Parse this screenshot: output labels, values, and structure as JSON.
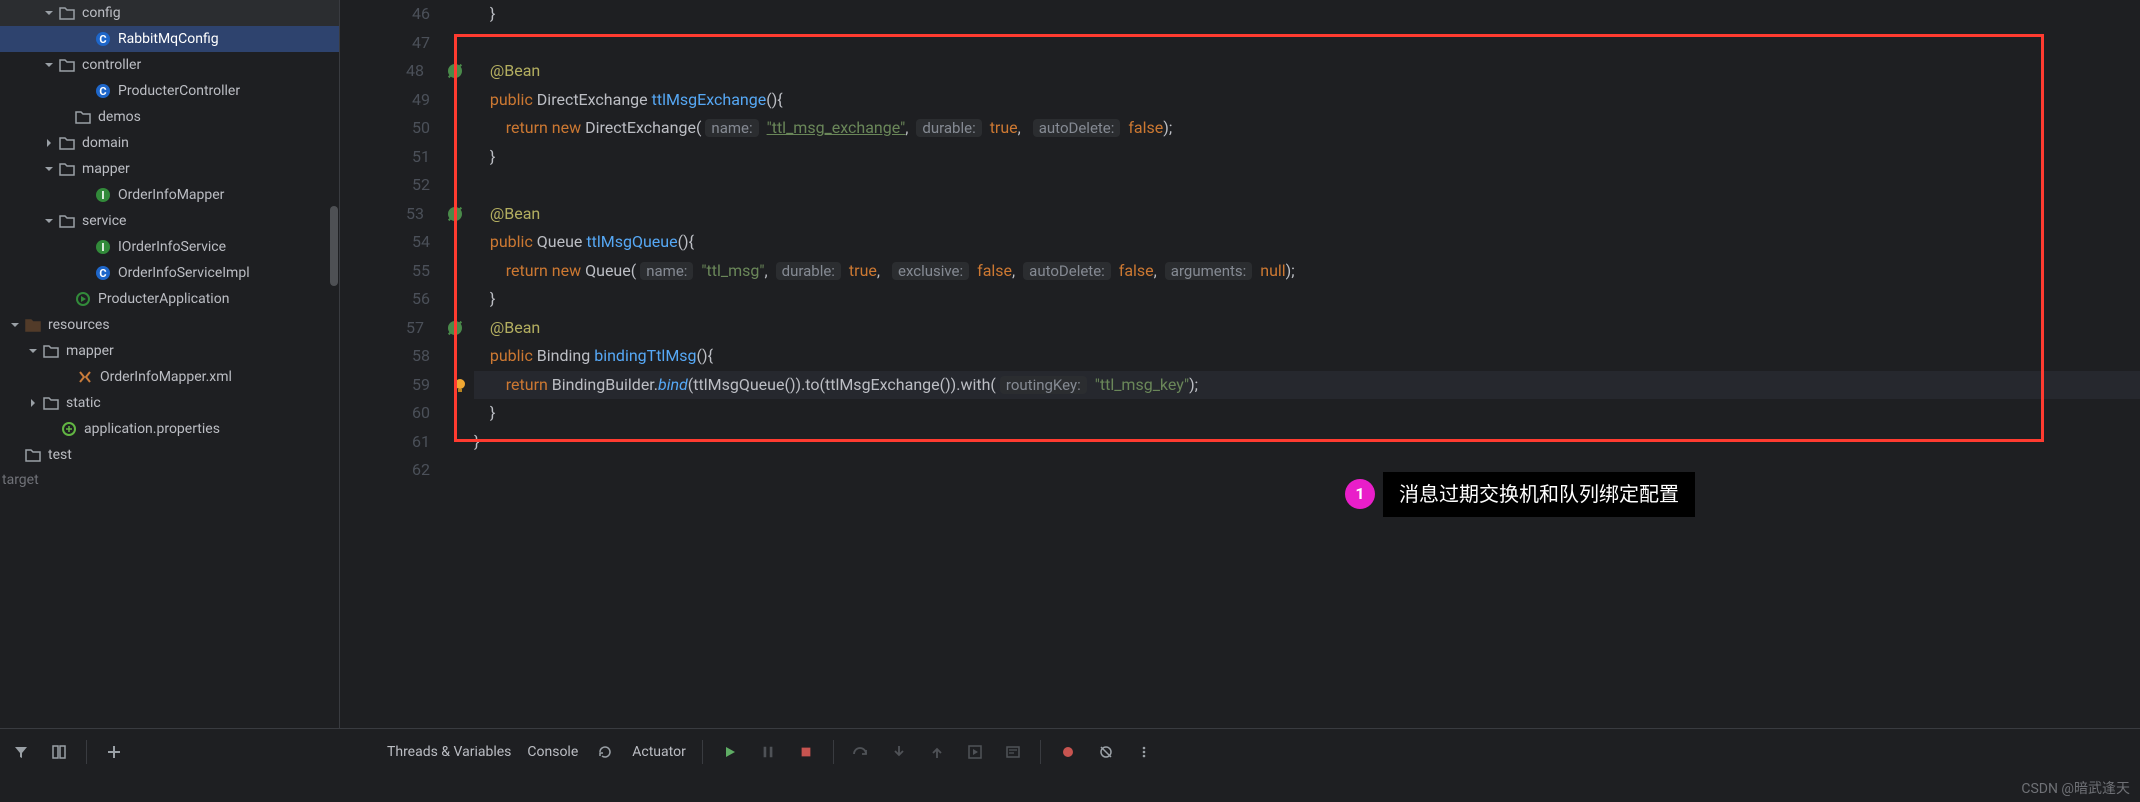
{
  "tree": {
    "config": "config",
    "rabbit": "RabbitMqConfig",
    "controller": "controller",
    "pcontroller": "ProducterController",
    "demos": "demos",
    "domain": "domain",
    "mapper": "mapper",
    "ordermapper": "OrderInfoMapper",
    "service": "service",
    "iorder": "IOrderInfoService",
    "orderimpl": "OrderInfoServiceImpl",
    "papp": "ProducterApplication",
    "resources": "resources",
    "mapperf": "mapper",
    "oxml": "OrderInfoMapper.xml",
    "static": "static",
    "aprop": "application.properties",
    "test": "test",
    "target": "target"
  },
  "lines": [
    "46",
    "47",
    "48",
    "49",
    "50",
    "51",
    "52",
    "53",
    "54",
    "55",
    "56",
    "57",
    "58",
    "59",
    "60",
    "61",
    "62"
  ],
  "code": {
    "bean": "@Bean",
    "public": "public",
    "return": "return",
    "new": "new",
    "direx": "DirectExchange",
    "ttlExFn": "ttlMsgExchange",
    "name": "name:",
    "ttl_ex_str": "\"ttl_msg_exchange\"",
    "durable": "durable:",
    "true": "true",
    "autoDel": "autoDelete:",
    "false": "false",
    "queue": "Queue",
    "ttlQFn": "ttlMsgQueue",
    "ttl_msg_str": "\"ttl_msg\"",
    "exclusive": "exclusive:",
    "arguments": "arguments:",
    "null": "null",
    "binding": "Binding",
    "bindFn": "bindingTtlMsg",
    "bbuilder": "BindingBuilder",
    "bind": "bind",
    "to": "to",
    "with": "with",
    "rkey": "routingKey:",
    "rkey_str": "\"ttl_msg_key\""
  },
  "callout": {
    "num": "1",
    "text": "消息过期交换机和队列绑定配置"
  },
  "toolbar": {
    "threads": "Threads & Variables",
    "console": "Console",
    "actuator": "Actuator"
  },
  "watermark": "CSDN @暗武逢天"
}
